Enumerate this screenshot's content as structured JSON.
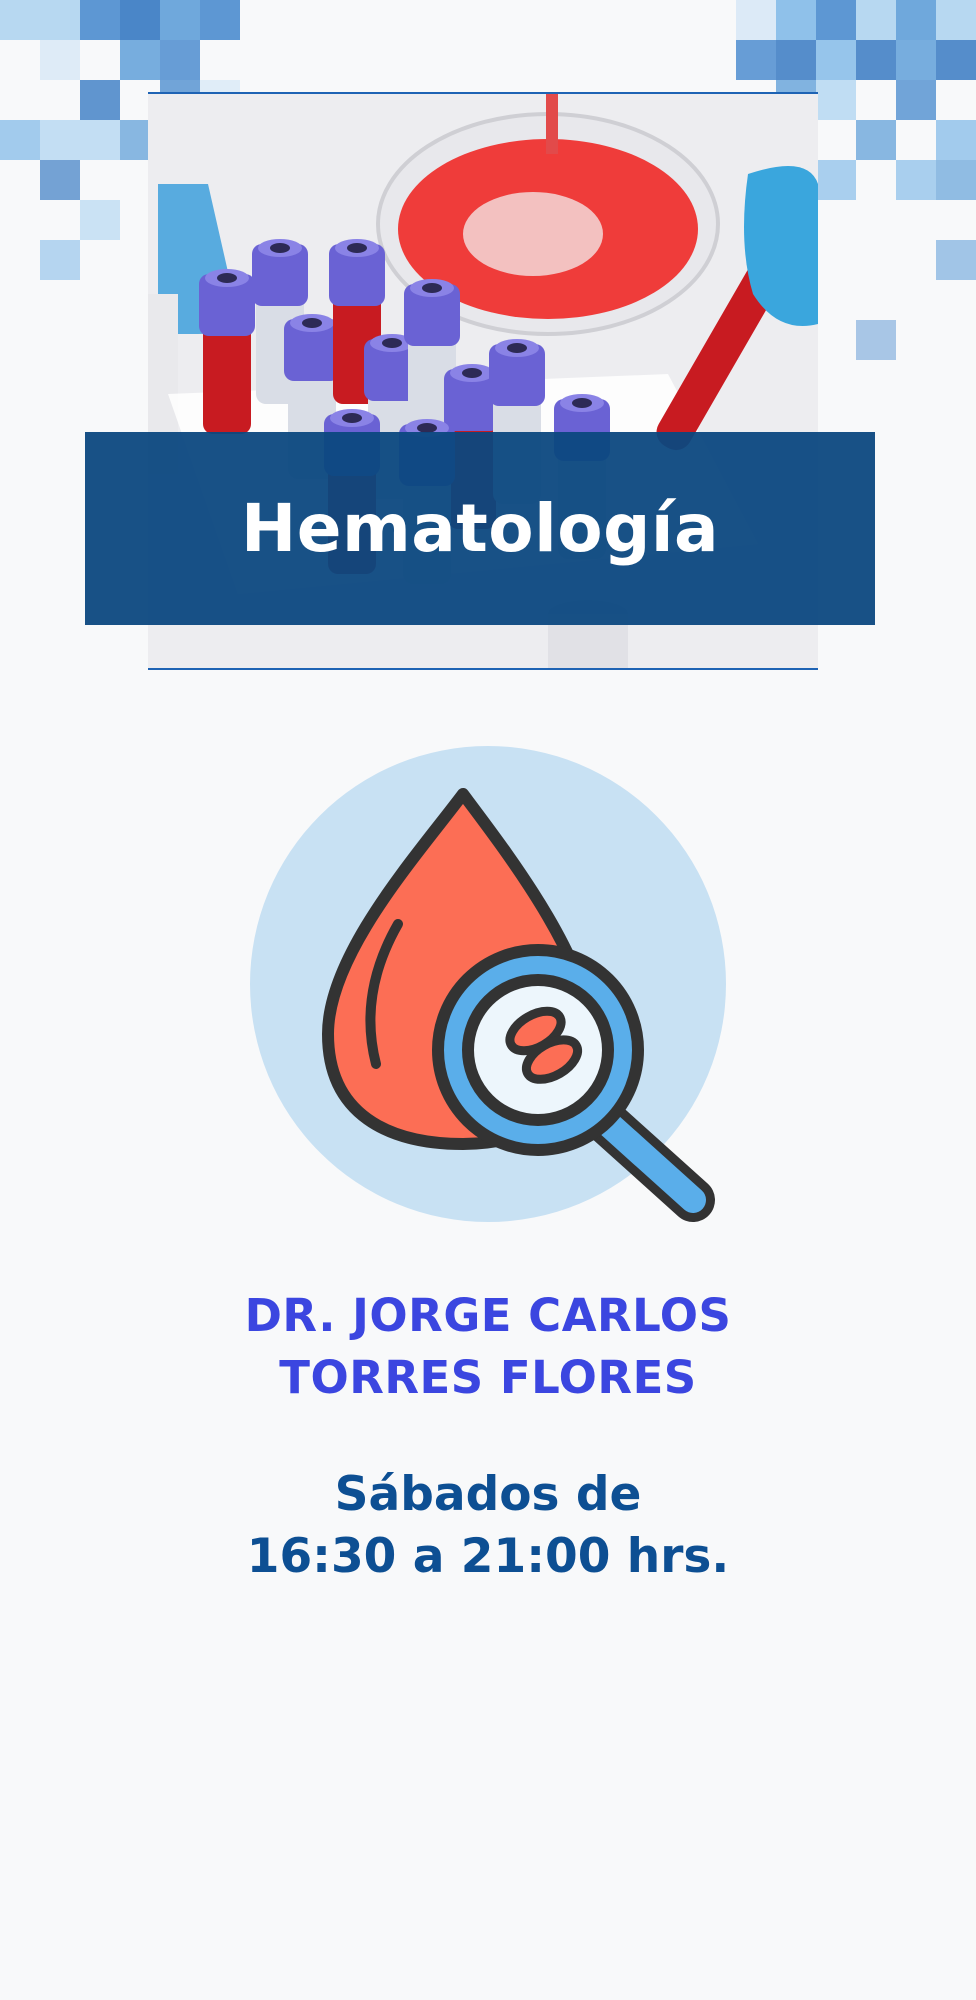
{
  "banner": {
    "title": "Hematología"
  },
  "doctor": {
    "line1": "DR. JORGE CARLOS",
    "line2": "TORRES FLORES"
  },
  "schedule": {
    "line1": "Sábados de",
    "line2": "16:30 a 21:00 hrs."
  },
  "colors": {
    "banner_bg": "#0c4880",
    "doctor_text": "#3b46e0",
    "schedule_text": "#0d4f93",
    "icon_circle": "#c8e1f3",
    "blood_drop": "#fc6e55",
    "magnifier_ring": "#5aaeea",
    "outline": "#333333"
  },
  "images": {
    "photo": "blood-sample-tubes-photo",
    "icon": "blood-drop-magnifier-icon",
    "decoration": "pixel-mosaic-pattern"
  }
}
